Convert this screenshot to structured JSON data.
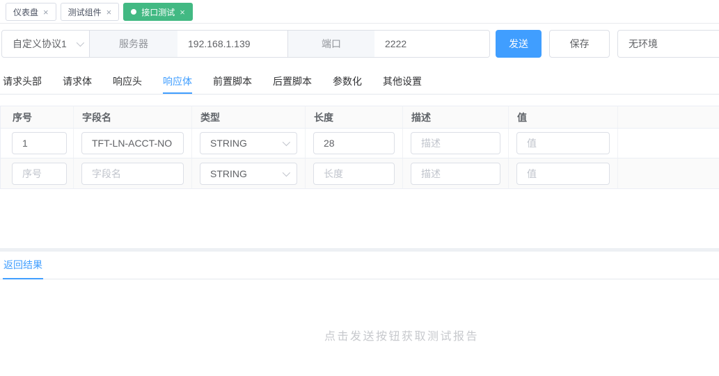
{
  "colors": {
    "accent_blue": "#409eff",
    "active_tab_green": "#42b983",
    "header_bg": "#fafafa",
    "label_bg": "#f5f7fa"
  },
  "icons": {
    "close": "×",
    "dot": "●"
  },
  "window_tabs": [
    {
      "label": "仪表盘",
      "active": false
    },
    {
      "label": "测试组件",
      "active": false
    },
    {
      "label": "接口测试",
      "active": true
    }
  ],
  "toolbar": {
    "protocol_selected": "自定义协议1",
    "server_label": "服务器",
    "server_value": "192.168.1.139",
    "port_label": "端口",
    "port_value": "2222",
    "send_label": "发送",
    "save_label": "保存",
    "environment_selected": "无环境"
  },
  "request_tabs": {
    "items": [
      "请求头部",
      "请求体",
      "响应头",
      "响应体",
      "前置脚本",
      "后置脚本",
      "参数化",
      "其他设置"
    ],
    "active": "响应体"
  },
  "table": {
    "headers": [
      "序号",
      "字段名",
      "类型",
      "长度",
      "描述",
      "值",
      ""
    ],
    "rows": [
      {
        "seq": "1",
        "field": "TFT-LN-ACCT-NO",
        "type": "STRING",
        "length": "28",
        "desc": "",
        "value": "",
        "desc_placeholder": "描述",
        "value_placeholder": "值"
      },
      {
        "seq_placeholder": "序号",
        "field_placeholder": "字段名",
        "type": "STRING",
        "length_placeholder": "长度",
        "desc_placeholder": "描述",
        "value_placeholder": "值"
      }
    ]
  },
  "result_panel": {
    "tab_label": "返回结果",
    "empty_message": "点击发送按钮获取测试报告"
  }
}
